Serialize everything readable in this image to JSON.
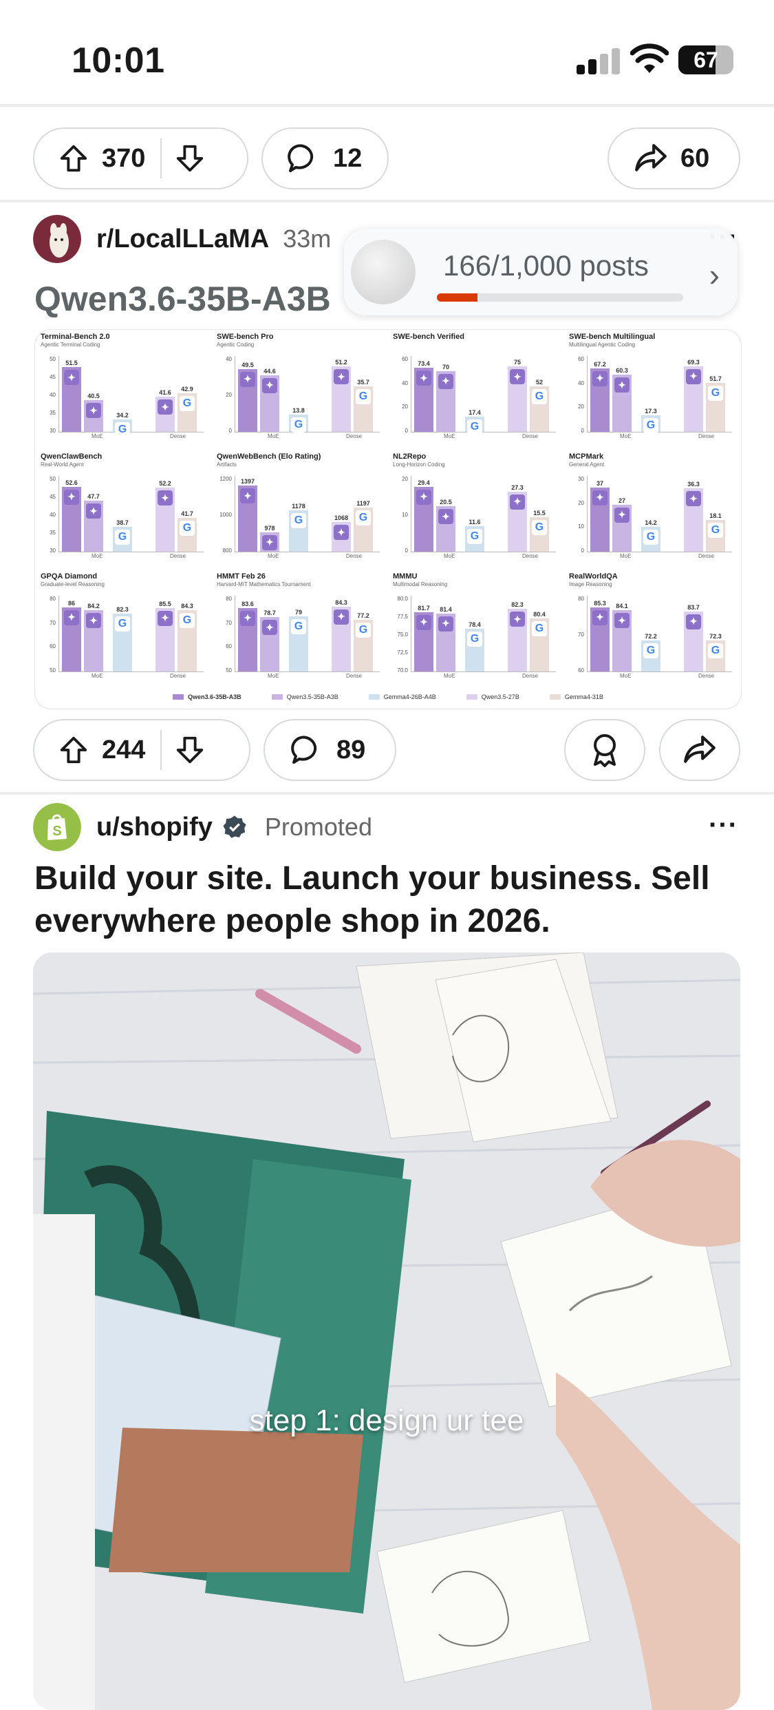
{
  "status_bar": {
    "time": "10:01",
    "battery": "67",
    "battery_level": 0.67
  },
  "post_top": {
    "upvotes": "370",
    "comments": "12",
    "shares": "60"
  },
  "post1": {
    "subreddit": "r/LocalLLaMA",
    "time_ago": "33m",
    "title": "Qwen3.6-35B-A3B",
    "upvotes": "244",
    "comments": "89"
  },
  "tracker": {
    "label": "166/1,000 posts",
    "progress": 0.166
  },
  "chart_data": [
    {
      "type": "bar",
      "title": "Terminal-Bench 2.0",
      "subtitle": "Agentic Terminal Coding",
      "yticks": [
        "50",
        "45",
        "40",
        "35",
        "30"
      ],
      "ylim": [
        30,
        52
      ],
      "categories": [
        "Qwen3.6-35B-A3B",
        "Qwen3.5-35B-A3B",
        "Gemma4-26B-A4B",
        "Qwen3.5-27B",
        "Gemma4-31B"
      ],
      "values": [
        51.5,
        40.5,
        34.2,
        41.6,
        42.9
      ],
      "groups": [
        "MoE",
        "Dense"
      ]
    },
    {
      "type": "bar",
      "title": "SWE-bench Pro",
      "subtitle": "Agentic Coding",
      "yticks": [
        "40",
        "20",
        "0"
      ],
      "ylim": [
        0,
        52
      ],
      "categories": [
        "Qwen3.6-35B-A3B",
        "Qwen3.5-35B-A3B",
        "Gemma4-26B-A4B",
        "Qwen3.5-27B",
        "Gemma4-31B"
      ],
      "values": [
        49.5,
        44.6,
        13.8,
        51.2,
        35.7
      ],
      "groups": [
        "MoE",
        "Dense"
      ]
    },
    {
      "type": "bar",
      "title": "SWE-bench Verified",
      "subtitle": "",
      "yticks": [
        "60",
        "40",
        "20",
        "0"
      ],
      "ylim": [
        0,
        76
      ],
      "categories": [
        "Qwen3.6-35B-A3B",
        "Qwen3.5-35B-A3B",
        "Gemma4-26B-A4B",
        "Qwen3.5-27B",
        "Gemma4-31B"
      ],
      "values": [
        73.4,
        70.0,
        17.4,
        75.0,
        52.0
      ],
      "groups": [
        "MoE",
        "Dense"
      ]
    },
    {
      "type": "bar",
      "title": "SWE-bench Multilingual",
      "subtitle": "Multilingual Agentic Coding",
      "yticks": [
        "60",
        "40",
        "20",
        "0"
      ],
      "ylim": [
        0,
        70
      ],
      "categories": [
        "Qwen3.6-35B-A3B",
        "Qwen3.5-35B-A3B",
        "Gemma4-26B-A4B",
        "Qwen3.5-27B",
        "Gemma4-31B"
      ],
      "values": [
        67.2,
        60.3,
        17.3,
        69.3,
        51.7
      ],
      "groups": [
        "MoE",
        "Dense"
      ]
    },
    {
      "type": "bar",
      "title": "QwenClawBench",
      "subtitle": "Real-World Agent",
      "yticks": [
        "50",
        "45",
        "40",
        "35",
        "30"
      ],
      "ylim": [
        30,
        53
      ],
      "categories": [
        "Qwen3.6-35B-A3B",
        "Qwen3.5-35B-A3B",
        "Gemma4-26B-A4B",
        "Qwen3.5-27B",
        "Gemma4-31B"
      ],
      "values": [
        52.6,
        47.7,
        38.7,
        52.2,
        41.7
      ],
      "groups": [
        "MoE",
        "Dense"
      ]
    },
    {
      "type": "bar",
      "title": "QwenWebBench (Elo Rating)",
      "subtitle": "Artifacts",
      "yticks": [
        "1200",
        "1000",
        "800"
      ],
      "ylim": [
        800,
        1400
      ],
      "categories": [
        "Qwen3.6-35B-A3B",
        "Qwen3.5-35B-A3B",
        "Gemma4-26B-A4B",
        "Qwen3.5-27B",
        "Gemma4-31B"
      ],
      "values": [
        1397,
        978,
        1178,
        1068,
        1197
      ],
      "groups": [
        "MoE",
        "Dense"
      ]
    },
    {
      "type": "bar",
      "title": "NL2Repo",
      "subtitle": "Long-Horizon Coding",
      "yticks": [
        "20",
        "10",
        "0"
      ],
      "ylim": [
        0,
        30
      ],
      "categories": [
        "Qwen3.6-35B-A3B",
        "Qwen3.5-35B-A3B",
        "Gemma4-26B-A4B",
        "Qwen3.5-27B",
        "Gemma4-31B"
      ],
      "values": [
        29.4,
        20.5,
        11.6,
        27.3,
        15.5
      ],
      "groups": [
        "MoE",
        "Dense"
      ]
    },
    {
      "type": "bar",
      "title": "MCPMark",
      "subtitle": "General Agent",
      "yticks": [
        "30",
        "20",
        "10",
        "0"
      ],
      "ylim": [
        0,
        38
      ],
      "categories": [
        "Qwen3.6-35B-A3B",
        "Qwen3.5-35B-A3B",
        "Gemma4-26B-A4B",
        "Qwen3.5-27B",
        "Gemma4-31B"
      ],
      "values": [
        37.0,
        27.0,
        14.2,
        36.3,
        18.1
      ],
      "groups": [
        "MoE",
        "Dense"
      ]
    },
    {
      "type": "bar",
      "title": "GPQA Diamond",
      "subtitle": "Graduate-level Reasoning",
      "yticks": [
        "80",
        "70",
        "60",
        "50"
      ],
      "ylim": [
        50,
        87
      ],
      "categories": [
        "Qwen3.6-35B-A3B",
        "Qwen3.5-35B-A3B",
        "Gemma4-26B-A4B",
        "Qwen3.5-27B",
        "Gemma4-31B"
      ],
      "values": [
        86.0,
        84.2,
        82.3,
        85.5,
        84.3
      ],
      "groups": [
        "MoE",
        "Dense"
      ]
    },
    {
      "type": "bar",
      "title": "HMMT Feb 26",
      "subtitle": "Harvard-MIT Mathematics Tournament",
      "yticks": [
        "80",
        "70",
        "60",
        "50"
      ],
      "ylim": [
        50,
        85
      ],
      "categories": [
        "Qwen3.6-35B-A3B",
        "Qwen3.5-35B-A3B",
        "Gemma4-26B-A4B",
        "Qwen3.5-27B",
        "Gemma4-31B"
      ],
      "values": [
        83.6,
        78.7,
        79.0,
        84.3,
        77.2
      ],
      "groups": [
        "MoE",
        "Dense"
      ]
    },
    {
      "type": "bar",
      "title": "MMMU",
      "subtitle": "Multimodal Reasoning",
      "yticks": [
        "80.0",
        "77.5",
        "75.0",
        "72.5",
        "70.0"
      ],
      "ylim": [
        70,
        83
      ],
      "categories": [
        "Qwen3.6-35B-A3B",
        "Qwen3.5-35B-A3B",
        "Gemma4-26B-A4B",
        "Qwen3.5-27B",
        "Gemma4-31B"
      ],
      "values": [
        81.7,
        81.4,
        78.4,
        82.3,
        80.4
      ],
      "groups": [
        "MoE",
        "Dense"
      ]
    },
    {
      "type": "bar",
      "title": "RealWorldQA",
      "subtitle": "Image Reasoning",
      "yticks": [
        "80",
        "70",
        "60"
      ],
      "ylim": [
        60,
        86
      ],
      "categories": [
        "Qwen3.6-35B-A3B",
        "Qwen3.5-35B-A3B",
        "Gemma4-26B-A4B",
        "Qwen3.5-27B",
        "Gemma4-31B"
      ],
      "values": [
        85.3,
        84.1,
        72.2,
        83.7,
        72.3
      ],
      "groups": [
        "MoE",
        "Dense"
      ]
    }
  ],
  "legend": [
    {
      "name": "Qwen3.6-35B-A3B",
      "color": "#a98bd0"
    },
    {
      "name": "Qwen3.5-35B-A3B",
      "color": "#c8b5e3"
    },
    {
      "name": "Gemma4-26B-A4B",
      "color": "#cfe0ee"
    },
    {
      "name": "Qwen3.5-27B",
      "color": "#ddd0ee"
    },
    {
      "name": "Gemma4-31B",
      "color": "#eaddd7"
    }
  ],
  "ad": {
    "author": "u/shopify",
    "promoted": "Promoted",
    "title": "Build your site. Launch your business. Sell everywhere people shop in 2026.",
    "caption": "step 1: design ur tee"
  },
  "colors": {
    "accent": "#d93a00",
    "shopify_green": "#95bf47"
  }
}
